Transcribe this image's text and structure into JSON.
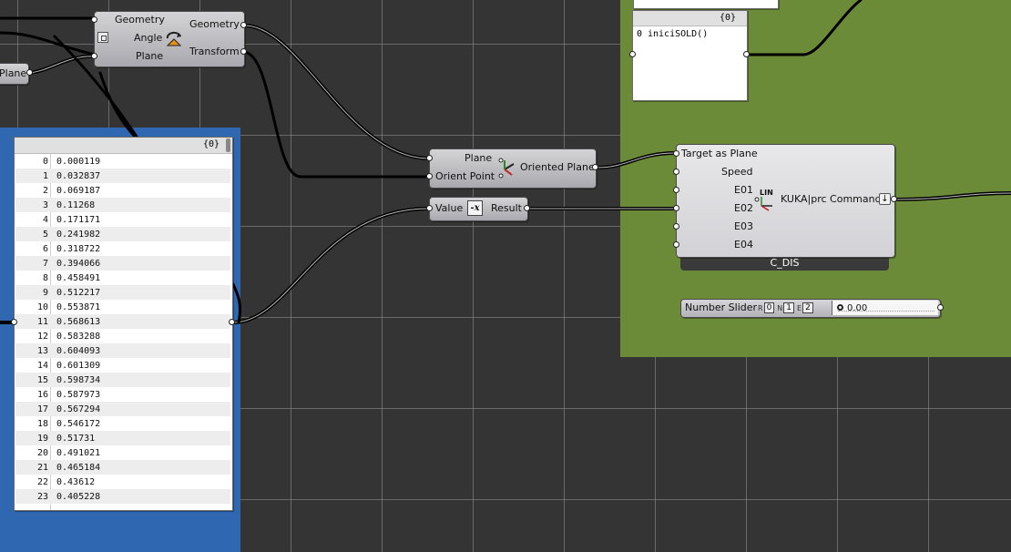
{
  "rotate": {
    "inputs": [
      "Geometry",
      "Angle",
      "Plane"
    ],
    "outputs": [
      "Geometry",
      "Transform"
    ],
    "icon": "rotate-icon"
  },
  "plane_stub": {
    "label": "Plane"
  },
  "list_panel": {
    "header": "{0}",
    "rows": [
      {
        "i": "0",
        "v": "0.000119"
      },
      {
        "i": "1",
        "v": "0.032837"
      },
      {
        "i": "2",
        "v": "0.069187"
      },
      {
        "i": "3",
        "v": "0.11268"
      },
      {
        "i": "4",
        "v": "0.171171"
      },
      {
        "i": "5",
        "v": "0.241982"
      },
      {
        "i": "6",
        "v": "0.318722"
      },
      {
        "i": "7",
        "v": "0.394066"
      },
      {
        "i": "8",
        "v": "0.458491"
      },
      {
        "i": "9",
        "v": "0.512217"
      },
      {
        "i": "10",
        "v": "0.553871"
      },
      {
        "i": "11",
        "v": "0.568613"
      },
      {
        "i": "12",
        "v": "0.583288"
      },
      {
        "i": "13",
        "v": "0.604093"
      },
      {
        "i": "14",
        "v": "0.601309"
      },
      {
        "i": "15",
        "v": "0.598734"
      },
      {
        "i": "16",
        "v": "0.587973"
      },
      {
        "i": "17",
        "v": "0.567294"
      },
      {
        "i": "18",
        "v": "0.546172"
      },
      {
        "i": "19",
        "v": "0.51731"
      },
      {
        "i": "20",
        "v": "0.491021"
      },
      {
        "i": "21",
        "v": "0.465184"
      },
      {
        "i": "22",
        "v": "0.43612"
      },
      {
        "i": "23",
        "v": "0.405228"
      }
    ]
  },
  "orient": {
    "inputs": [
      "Plane",
      "Orient Point"
    ],
    "output": "Oriented Plane",
    "icon": "orient-plane-icon"
  },
  "expr": {
    "input": "Value",
    "output": "Result",
    "icon_text": "-x"
  },
  "text_panel": {
    "header": "{0}",
    "index": "0",
    "value": "iniciSOLD()"
  },
  "kuka": {
    "inputs": [
      "Target as Plane",
      "Speed",
      "E01",
      "E02",
      "E03",
      "E04"
    ],
    "icon_text": "LIN",
    "output": "KUKA|prc Command",
    "name": "C_DIS"
  },
  "slider": {
    "label": "Number Slider",
    "r": "R",
    "r_value": "0",
    "n": "N",
    "n_value": "1",
    "e": "E",
    "e_value": "2",
    "value": "0.00"
  },
  "colors": {
    "canvas": "#343434",
    "blue_group": "#2f68b0",
    "green_group": "#6c8b38",
    "wire": "#000000"
  }
}
